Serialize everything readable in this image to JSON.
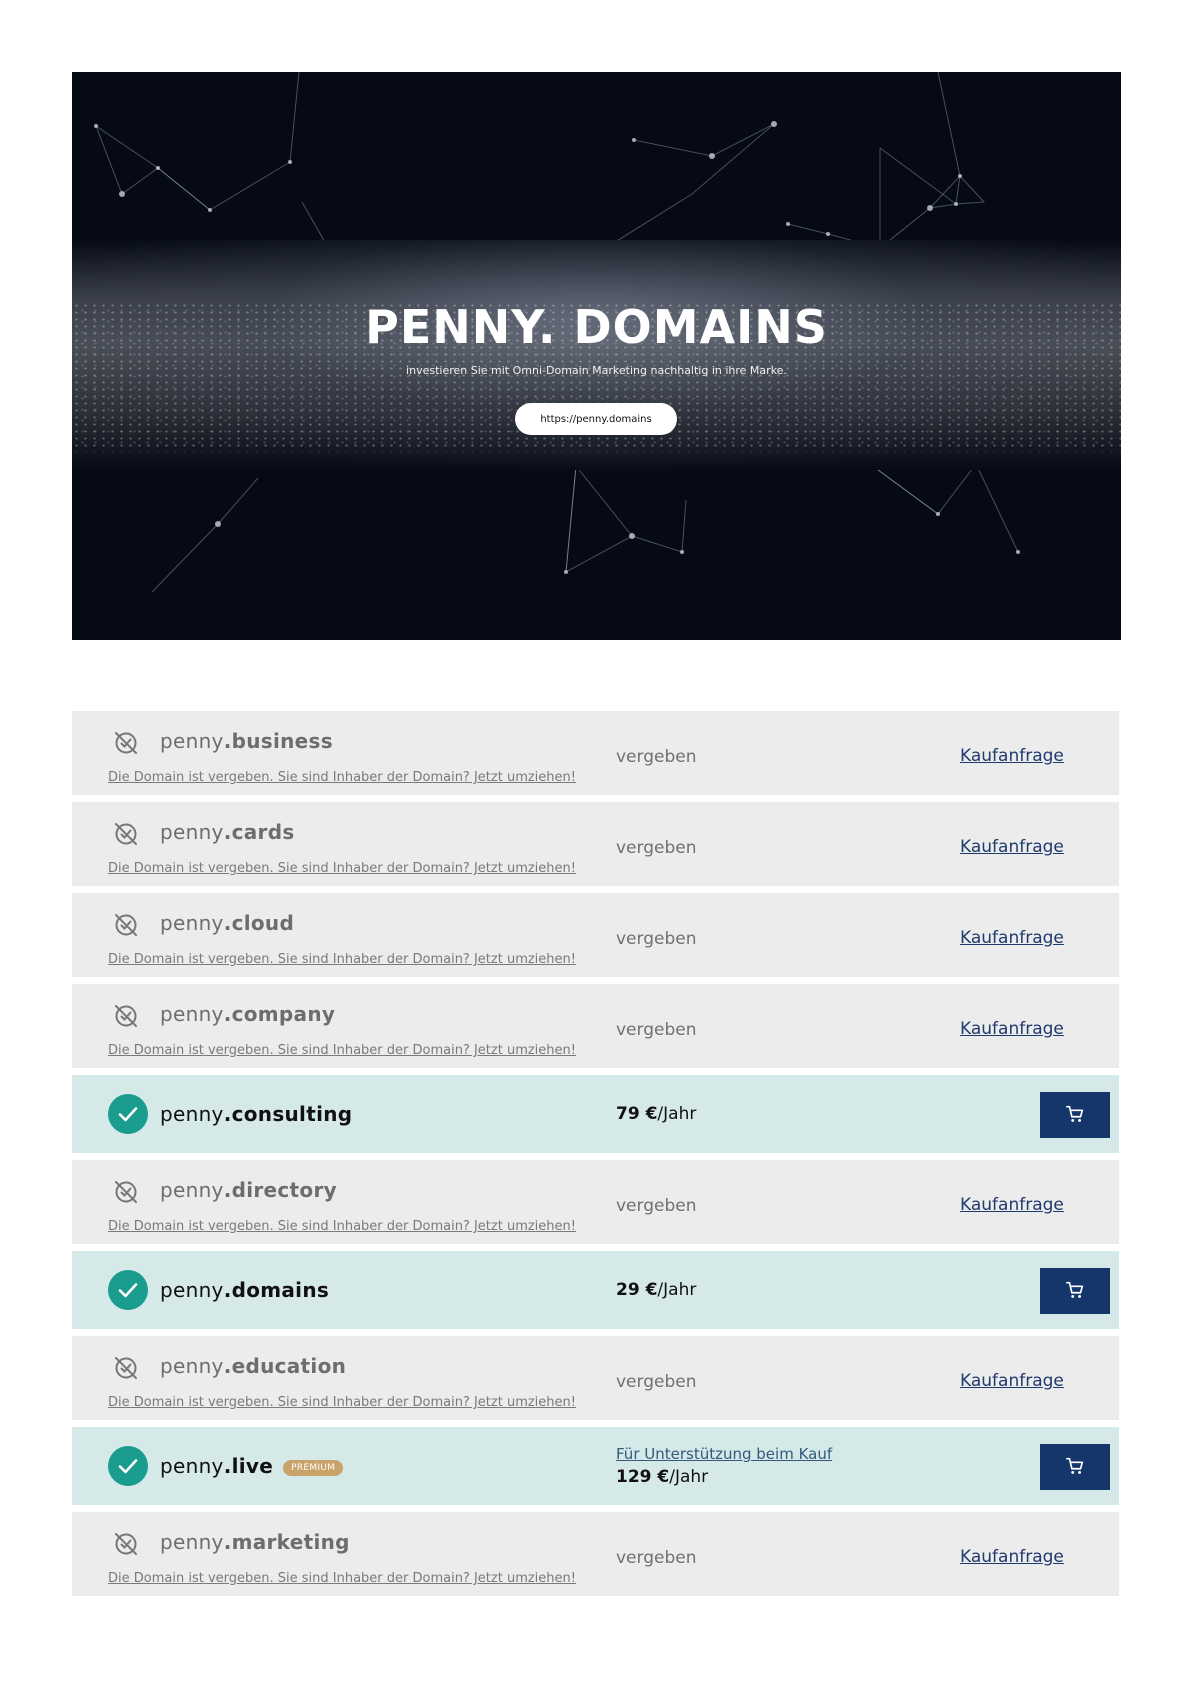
{
  "hero": {
    "title": "PENNY. DOMAINS",
    "subtitle": "investieren Sie mit Omni-Domain Marketing nachhaltig in ihre Marke.",
    "button_label": "https://penny.domains"
  },
  "colors": {
    "taken_row_bg": "#ececec",
    "available_row_bg": "#d4e9e8",
    "check_circle": "#1a9d8e",
    "cart_button": "#15366b",
    "link": "#1e3b6e",
    "premium_badge": "#c9a36a"
  },
  "domains": [
    {
      "prefix": "penny",
      "tld": ".business",
      "status": "taken",
      "state_label": "vergeben",
      "hint": "Die Domain ist vergeben. Sie sind Inhaber der Domain? Jetzt umziehen!",
      "action_label": "Kaufanfrage",
      "icon": "domain-taken-icon"
    },
    {
      "prefix": "penny",
      "tld": ".cards",
      "status": "taken",
      "state_label": "vergeben",
      "hint": "Die Domain ist vergeben. Sie sind Inhaber der Domain? Jetzt umziehen!",
      "action_label": "Kaufanfrage",
      "icon": "domain-taken-icon"
    },
    {
      "prefix": "penny",
      "tld": ".cloud",
      "status": "taken",
      "state_label": "vergeben",
      "hint": "Die Domain ist vergeben. Sie sind Inhaber der Domain? Jetzt umziehen!",
      "action_label": "Kaufanfrage",
      "icon": "domain-taken-icon"
    },
    {
      "prefix": "penny",
      "tld": ".company",
      "status": "taken",
      "state_label": "vergeben",
      "hint": "Die Domain ist vergeben. Sie sind Inhaber der Domain? Jetzt umziehen!",
      "action_label": "Kaufanfrage",
      "icon": "domain-taken-icon"
    },
    {
      "prefix": "penny",
      "tld": ".consulting",
      "status": "available",
      "price": "79 €",
      "unit": "/Jahr",
      "icon": "checkmark-icon",
      "cart_icon": "shopping-cart-icon"
    },
    {
      "prefix": "penny",
      "tld": ".directory",
      "status": "taken",
      "state_label": "vergeben",
      "hint": "Die Domain ist vergeben. Sie sind Inhaber der Domain? Jetzt umziehen!",
      "action_label": "Kaufanfrage",
      "icon": "domain-taken-icon"
    },
    {
      "prefix": "penny",
      "tld": ".domains",
      "status": "available",
      "price": "29 €",
      "unit": "/Jahr",
      "icon": "checkmark-icon",
      "cart_icon": "shopping-cart-icon"
    },
    {
      "prefix": "penny",
      "tld": ".education",
      "status": "taken",
      "state_label": "vergeben",
      "hint": "Die Domain ist vergeben. Sie sind Inhaber der Domain? Jetzt umziehen!",
      "action_label": "Kaufanfrage",
      "icon": "domain-taken-icon"
    },
    {
      "prefix": "penny",
      "tld": ".live",
      "status": "available",
      "badge": "PREMIUM",
      "support": "Für Unterstützung beim Kauf",
      "price": "129 €",
      "unit": "/Jahr",
      "icon": "checkmark-icon",
      "cart_icon": "shopping-cart-icon"
    },
    {
      "prefix": "penny",
      "tld": ".marketing",
      "status": "taken",
      "state_label": "vergeben",
      "hint": "Die Domain ist vergeben. Sie sind Inhaber der Domain? Jetzt umziehen!",
      "action_label": "Kaufanfrage",
      "icon": "domain-taken-icon"
    }
  ]
}
